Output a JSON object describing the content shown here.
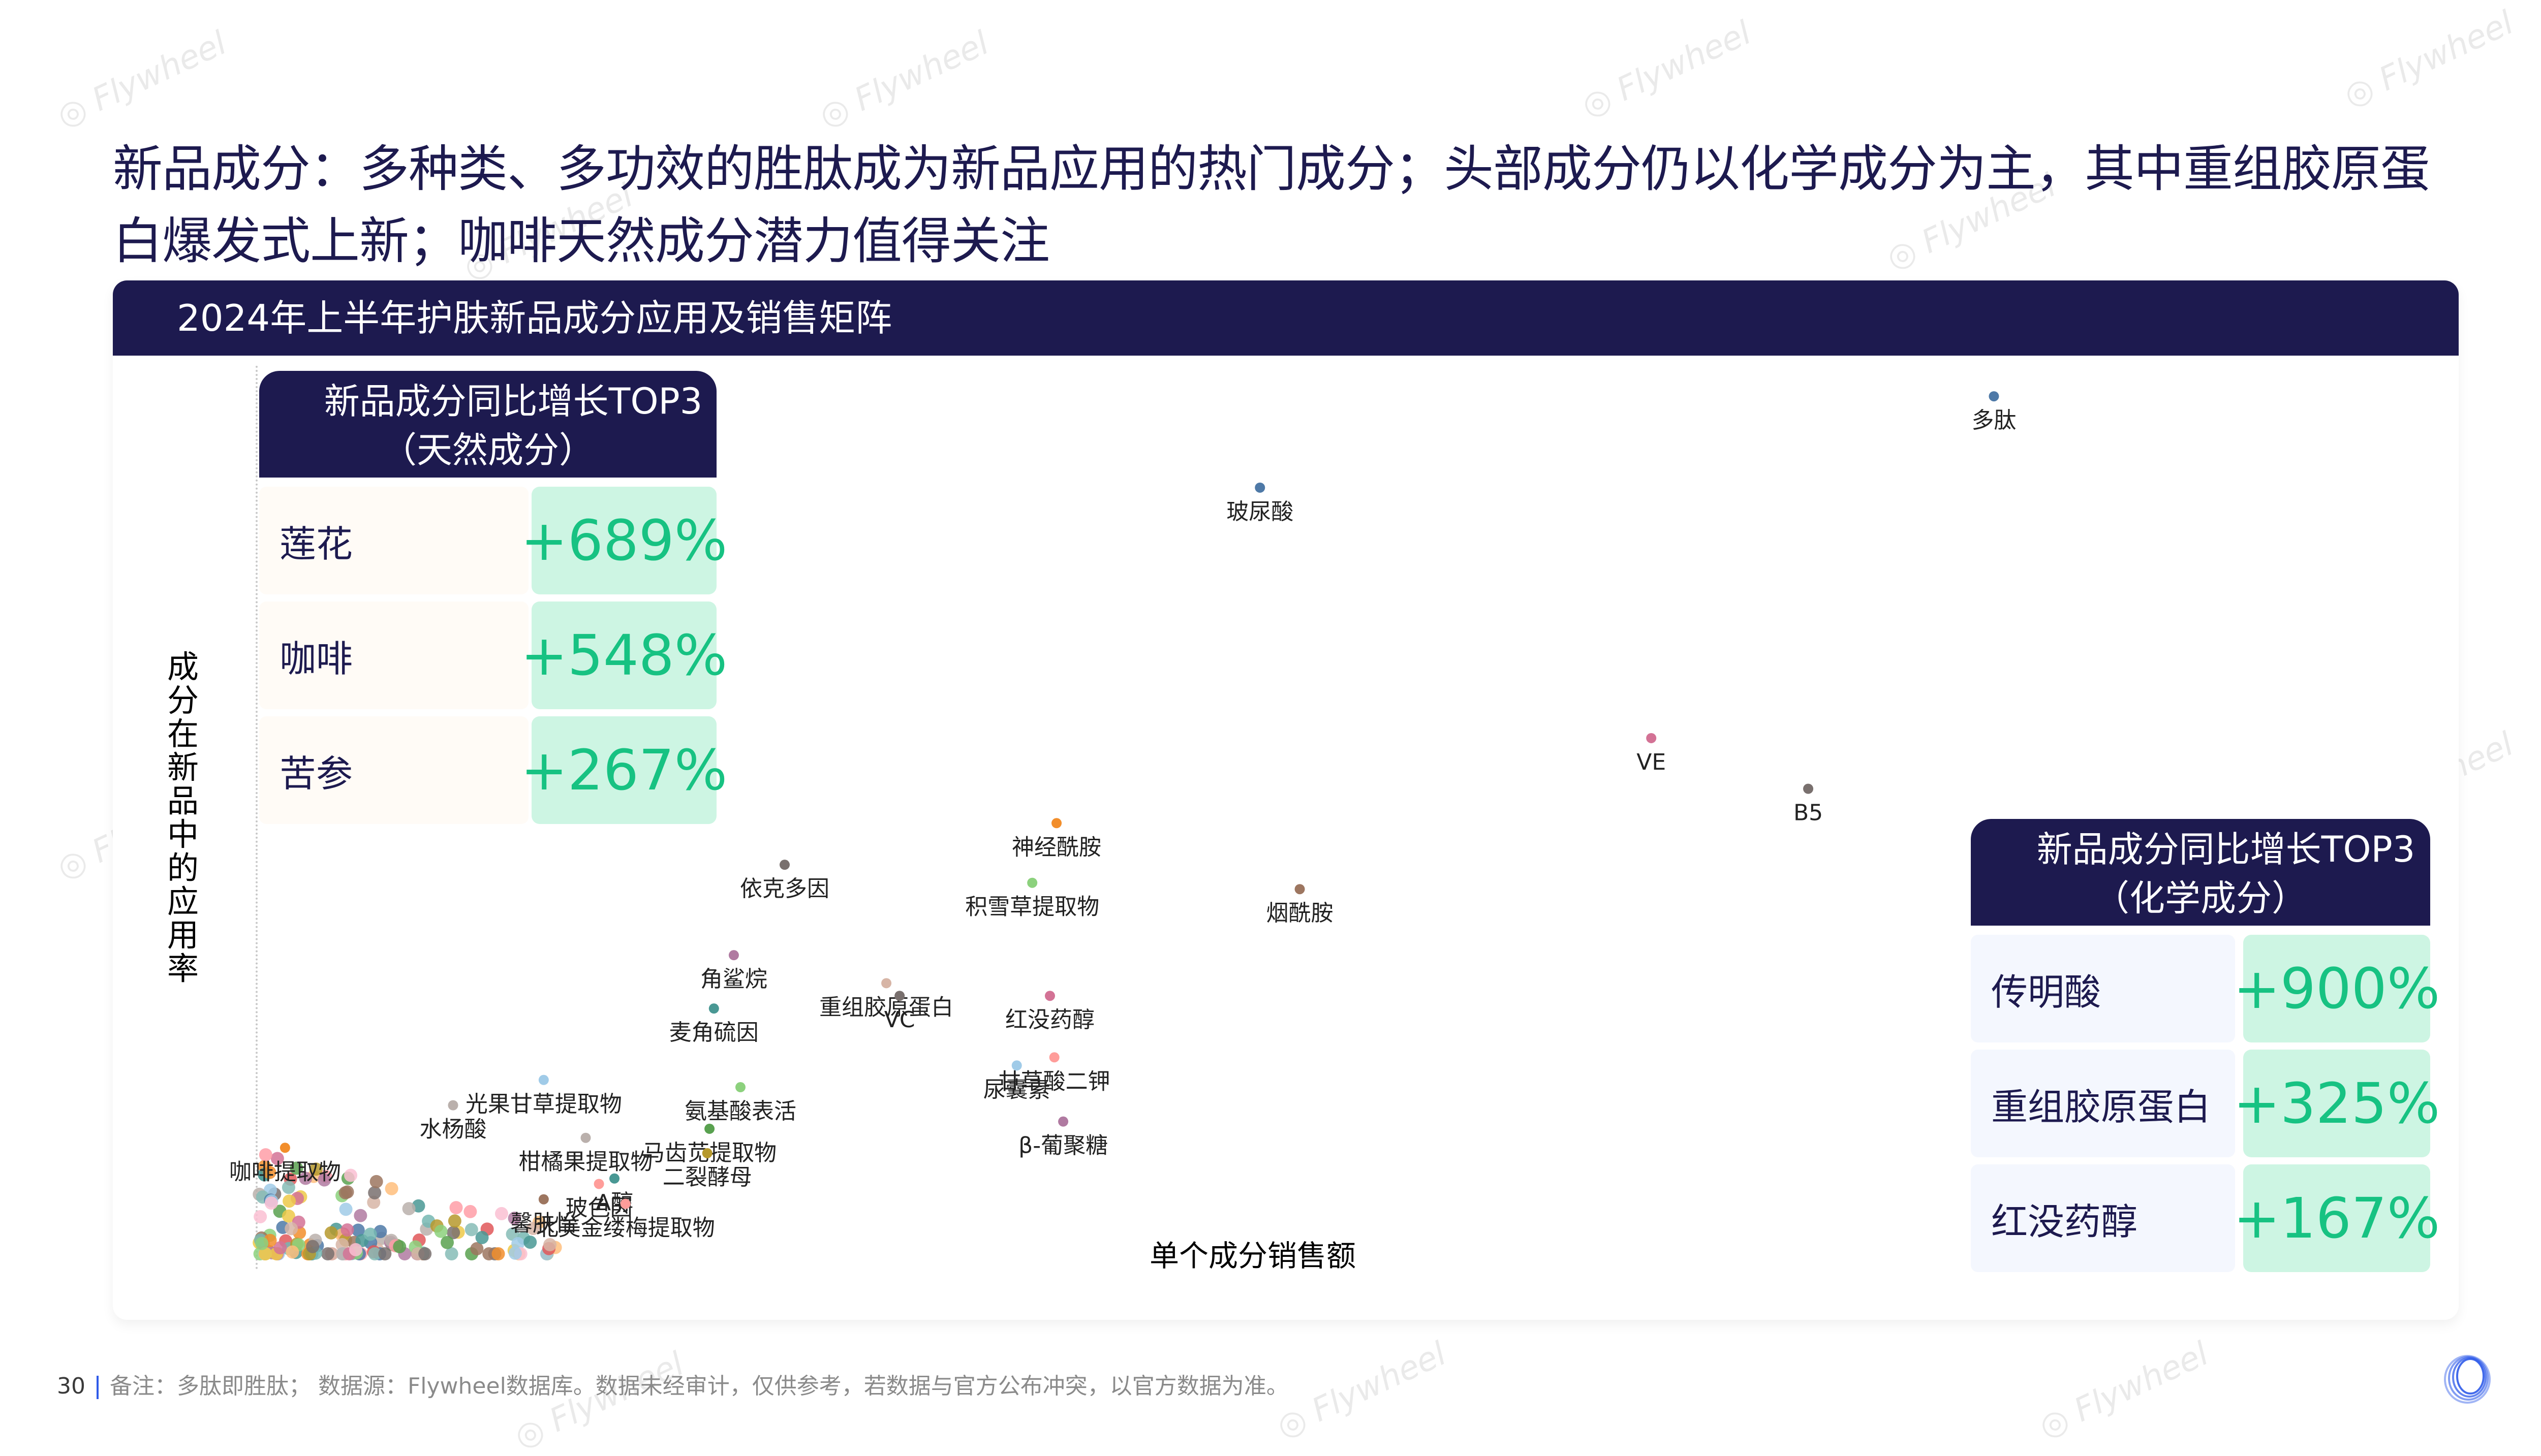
{
  "headline": "新品成分：多种类、多功效的胜肽成为新品应用的热门成分；头部成分仍以化学成分为主，其中重组胶原蛋白爆发式上新；咖啡天然成分潜力值得关注",
  "card_title": "2024年上半年护肤新品成分应用及销售矩阵",
  "top3_natural": {
    "title_line1": "新品成分同比增长TOP3",
    "title_line2": "（天然成分）",
    "rows": [
      {
        "name": "莲花",
        "value": "+689%"
      },
      {
        "name": "咖啡",
        "value": "+548%"
      },
      {
        "name": "苦参",
        "value": "+267%"
      }
    ]
  },
  "top3_chemical": {
    "title_line1": "新品成分同比增长TOP3",
    "title_line2": "（化学成分）",
    "rows": [
      {
        "name": "传明酸",
        "value": "+900%"
      },
      {
        "name": "重组胶原蛋白",
        "value": "+325%"
      },
      {
        "name": "红没药醇",
        "value": "+167%"
      }
    ]
  },
  "footer": {
    "page_number": "30",
    "note": "备注：多肽即胜肽；  数据源：Flywheel数据库。数据未经审计，仅供参考，若数据与官方公布冲突，以官方数据为准。"
  },
  "watermark_text": "Flywheel",
  "colors": {
    "navy": "#1d1a4f",
    "growth_green": "#17c282",
    "growth_bg": "#cdf5e3",
    "logo_blue": "#2f5be9"
  },
  "chart_data": {
    "type": "scatter",
    "title": "2024年上半年护肤新品成分应用及销售矩阵",
    "xlabel": "单个成分销售额",
    "ylabel": "成分在新品中的应用率",
    "xlim": [
      0,
      100
    ],
    "ylim": [
      0,
      100
    ],
    "units": "relative (axes unlabeled, no ticks)",
    "grid": false,
    "legend": "none",
    "points": [
      {
        "label": "多肽",
        "x": 78.7,
        "y": 95.5,
        "color": "#4e79a7"
      },
      {
        "label": "玻尿酸",
        "x": 45.5,
        "y": 85.4,
        "color": "#4e79a7"
      },
      {
        "label": "VE",
        "x": 63.2,
        "y": 57.7,
        "color": "#d37295"
      },
      {
        "label": "B5",
        "x": 70.3,
        "y": 52.1,
        "color": "#79706e"
      },
      {
        "label": "神经酰胺",
        "x": 36.3,
        "y": 48.3,
        "color": "#f28e2b"
      },
      {
        "label": "依克多因",
        "x": 24.0,
        "y": 43.7,
        "color": "#79706e"
      },
      {
        "label": "积雪草提取物",
        "x": 35.2,
        "y": 41.7,
        "color": "#8cd17d"
      },
      {
        "label": "烟酰胺",
        "x": 47.3,
        "y": 41.0,
        "color": "#9d7660"
      },
      {
        "label": "角鲨烷",
        "x": 21.7,
        "y": 33.7,
        "color": "#b07aa1"
      },
      {
        "label": "重组胶原蛋白",
        "x": 28.6,
        "y": 30.6,
        "color": "#d7b5a6"
      },
      {
        "label": "VC",
        "x": 29.2,
        "y": 29.2,
        "color": "#79706e"
      },
      {
        "label": "红没药醇",
        "x": 36.0,
        "y": 29.2,
        "color": "#d37295"
      },
      {
        "label": "麦角硫因",
        "x": 20.8,
        "y": 27.8,
        "color": "#499894"
      },
      {
        "label": "甘草酸二钾",
        "x": 36.2,
        "y": 22.4,
        "color": "#ff9d9a"
      },
      {
        "label": "尿囊素",
        "x": 34.5,
        "y": 21.5,
        "color": "#a0cbe8"
      },
      {
        "label": "光果甘草提取物",
        "x": 13.1,
        "y": 19.9,
        "color": "#a0cbe8"
      },
      {
        "label": "氨基酸表活",
        "x": 22.0,
        "y": 19.1,
        "color": "#8cd17d"
      },
      {
        "label": "水杨酸",
        "x": 9.0,
        "y": 17.1,
        "color": "#bab0ac"
      },
      {
        "label": "β-葡聚糖",
        "x": 36.6,
        "y": 15.3,
        "color": "#b07aa1"
      },
      {
        "label": "马齿苋提取物",
        "x": 20.6,
        "y": 14.5,
        "color": "#59a14f"
      },
      {
        "label": "柑橘果提取物",
        "x": 15.0,
        "y": 13.5,
        "color": "#bab0ac"
      },
      {
        "label": "咖啡提取物",
        "x": 1.4,
        "y": 12.4,
        "color": "#f28e2b"
      },
      {
        "label": "二裂酵母",
        "x": 20.5,
        "y": 11.8,
        "color": "#b6992d"
      },
      {
        "label": "A醇",
        "x": 16.3,
        "y": 9.0,
        "color": "#499894"
      },
      {
        "label": "玻色因",
        "x": 15.6,
        "y": 8.4,
        "color": "#ff9d9a"
      },
      {
        "label": "馨肤怡",
        "x": 13.1,
        "y": 6.7,
        "color": "#9d7660"
      },
      {
        "label": "北美金缕梅提取物",
        "x": 16.8,
        "y": 6.2,
        "color": "#ff9d9a"
      }
    ],
    "unlabeled_cluster_note": "Dense cloud of ~150 small unlabeled points near origin (x 0–14, y 0–12)"
  }
}
